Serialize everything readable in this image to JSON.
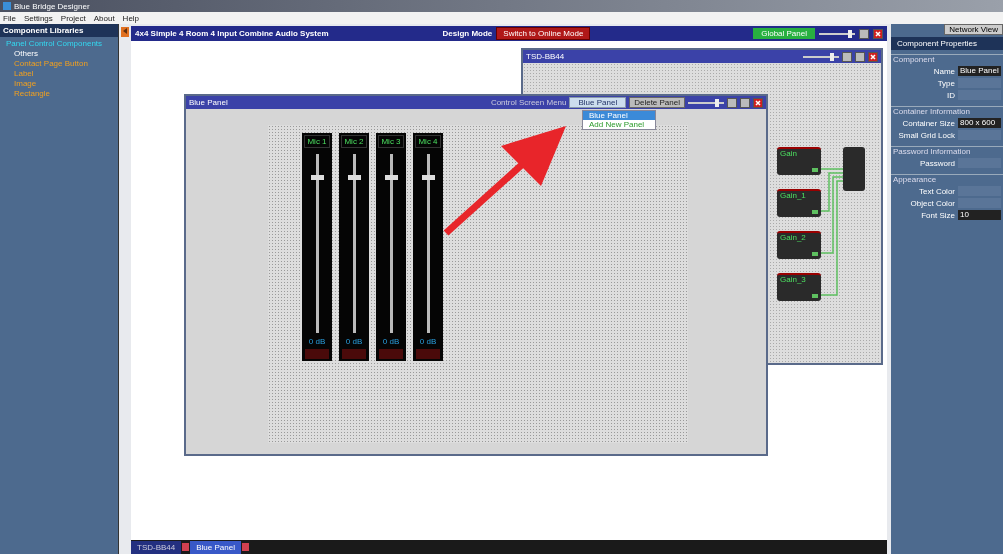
{
  "app_title": "Blue Bridge Designer",
  "menu": [
    "File",
    "Settings",
    "Project",
    "About",
    "Help"
  ],
  "libraries": {
    "title": "Component Libraries",
    "category": "Panel Control Components",
    "items": [
      {
        "label": "Others",
        "kind": "group"
      },
      {
        "label": "Contact Page Button",
        "kind": "item"
      },
      {
        "label": "Label",
        "kind": "item"
      },
      {
        "label": "Image",
        "kind": "item"
      },
      {
        "label": "Rectangle",
        "kind": "item"
      }
    ]
  },
  "canvas": {
    "title": "4x4 Simple 4 Room 4 Input Combine Audio System",
    "mode_label": "Design Mode",
    "mode_button": "Switch to Online Mode",
    "panel_button": "Global Panel",
    "zoom": {
      "level": 0.85
    }
  },
  "tsd_window": {
    "title": "TSD-BB44",
    "zoom": {
      "level": 0.8
    },
    "blocks": [
      {
        "label": "Gain"
      },
      {
        "label": "Gain_1"
      },
      {
        "label": "Gain_2"
      },
      {
        "label": "Gain_3"
      }
    ]
  },
  "panel_window": {
    "title": "Blue Panel",
    "menu_label": "Control Screen Menu",
    "panel_select": "Blue Panel",
    "delete_button": "Delete Panel",
    "zoom": {
      "level": 0.8
    },
    "options": [
      {
        "label": "Blue Panel",
        "selected": true
      },
      {
        "label": "Add New Panel",
        "selected": false
      }
    ],
    "faders": [
      {
        "label": "Mic 1",
        "level": 0.88,
        "reading": "0 dB"
      },
      {
        "label": "Mic 2",
        "level": 0.88,
        "reading": "0 dB"
      },
      {
        "label": "Mic 3",
        "level": 0.88,
        "reading": "0 dB"
      },
      {
        "label": "Mic 4",
        "level": 0.88,
        "reading": "0 dB"
      }
    ]
  },
  "properties": {
    "network_button": "Network View",
    "title": "Component Properties",
    "sections": [
      {
        "title": "Component",
        "rows": [
          {
            "label": "Name",
            "value": "Blue Panel"
          },
          {
            "label": "Type"
          },
          {
            "label": "ID"
          }
        ]
      },
      {
        "title": "Container Information",
        "rows": [
          {
            "label": "Container Size",
            "value": "800 x 600"
          },
          {
            "label": "Small Grid Lock"
          }
        ]
      },
      {
        "title": "Password Information",
        "rows": [
          {
            "label": "Password"
          }
        ]
      },
      {
        "title": "Appearance",
        "rows": [
          {
            "label": "Text Color"
          },
          {
            "label": "Object Color"
          },
          {
            "label": "Font Size",
            "value": "10"
          }
        ]
      }
    ]
  },
  "taskbar": [
    {
      "label": "TSD-BB44",
      "selected": false
    },
    {
      "label": "Blue Panel",
      "selected": true
    }
  ]
}
